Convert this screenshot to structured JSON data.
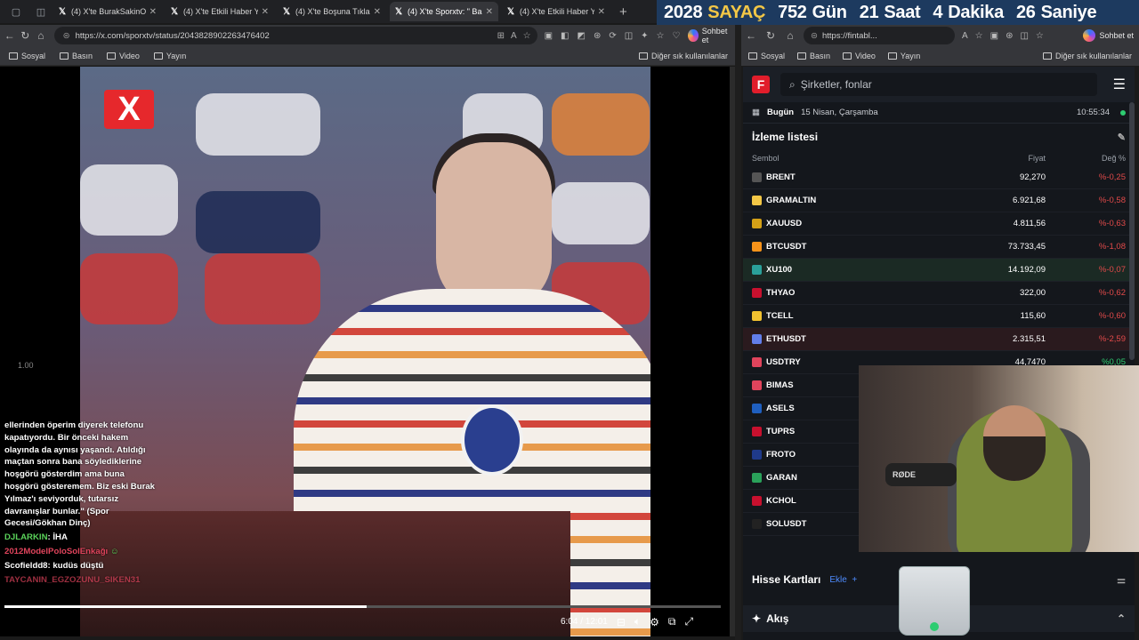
{
  "left_browser": {
    "tabs": [
      {
        "title": "(4) X'te BurakSakinOl: \"G",
        "active": false
      },
      {
        "title": "(4) X'te Etkili Haber Yeni",
        "active": false
      },
      {
        "title": "(4) X'te Boşuna Tıklama:",
        "active": false
      },
      {
        "title": "(4) X'te Sporxtv: \" Bah",
        "active": true
      },
      {
        "title": "(4) X'te Etkili Haber Yeni",
        "active": false
      }
    ],
    "url": "https://x.com/sporxtv/status/2043828902263476402",
    "sohbet": "Sohbet et",
    "bookmarks": [
      "Sosyal",
      "Basın",
      "Video",
      "Yayın"
    ],
    "other_bookmarks": "Diğer sık kullanılanlar"
  },
  "countdown": {
    "year": "2028",
    "label": "SAYAÇ",
    "days": "752",
    "days_label": "Gün",
    "hours": "21",
    "hours_label": "Saat",
    "minutes": "4",
    "minutes_label": "Dakika",
    "seconds": "26",
    "seconds_label": "Saniye"
  },
  "video": {
    "ratio_label": "1.00",
    "time": "6:04 / 12:01",
    "progress": 0.505,
    "badge": "X"
  },
  "chat": {
    "quote": "ellerinden öperim diyerek telefonu kapatıyordu. Bir önceki hakem olayında da aynısı yaşandı. Atıldığı maçtan sonra bana söylediklerine hoşgörü gösterdim ama buna hoşgörü gösteremem. Biz eski Burak Yılmaz'ı seviyorduk, tutarsız davranışlar bunlar.\" (Spor Gecesi/Gökhan Dinç)",
    "lines": [
      {
        "user": "DJLARKIN",
        "text": "İHA"
      },
      {
        "user": "2012ModelPoloSolEnkağı",
        "text": ""
      },
      {
        "user": "Scofieldd8",
        "text": "kudüs düştü"
      },
      {
        "user": "TAYCANIN_EGZOZUNU_SIKEN31",
        "text": ""
      }
    ]
  },
  "right_browser": {
    "url": "https://fintabl...",
    "sohbet": "Sohbet et",
    "bookmarks": [
      "Sosyal",
      "Basın",
      "Video",
      "Yayın"
    ],
    "other_bookmarks": "Diğer sık kullanılanlar"
  },
  "fintables": {
    "logo": "F",
    "search_placeholder": "Şirketler, fonlar",
    "today_label": "Bugün",
    "date": "15 Nisan, Çarşamba",
    "time": "10:55:34",
    "watchlist_title": "İzleme listesi",
    "col_symbol": "Sembol",
    "col_price": "Fiyat",
    "col_change": "Değ %",
    "rows": [
      {
        "symbol": "BRENT",
        "price": "92,270",
        "change": "%-0,25",
        "icon_color": "#555555",
        "pos": false
      },
      {
        "symbol": "GRAMALTIN",
        "price": "6.921,68",
        "change": "%-0,58",
        "icon_color": "#f3c746",
        "pos": false
      },
      {
        "symbol": "XAUUSD",
        "price": "4.811,56",
        "change": "%-0,63",
        "icon_color": "#d4a017",
        "pos": false
      },
      {
        "symbol": "BTCUSDT",
        "price": "73.733,45",
        "change": "%-1,08",
        "icon_color": "#f7931a",
        "pos": false
      },
      {
        "symbol": "XU100",
        "price": "14.192,09",
        "change": "%-0,07",
        "icon_color": "#2aa19a",
        "pos": false
      },
      {
        "symbol": "THYAO",
        "price": "322,00",
        "change": "%-0,62",
        "icon_color": "#c8102e",
        "pos": false
      },
      {
        "symbol": "TCELL",
        "price": "115,60",
        "change": "%-0,60",
        "icon_color": "#f2c230",
        "pos": false
      },
      {
        "symbol": "ETHUSDT",
        "price": "2.315,51",
        "change": "%-2,59",
        "icon_color": "#627eea",
        "pos": false
      },
      {
        "symbol": "USDTRY",
        "price": "44,7470",
        "change": "%0,05",
        "icon_color": "#e0445c",
        "pos": true
      },
      {
        "symbol": "BIMAS",
        "price": "",
        "change": "",
        "icon_color": "#e0445c",
        "pos": false
      },
      {
        "symbol": "ASELS",
        "price": "",
        "change": "",
        "icon_color": "#1f5fbf",
        "pos": false
      },
      {
        "symbol": "TUPRS",
        "price": "",
        "change": "",
        "icon_color": "#c8102e",
        "pos": false
      },
      {
        "symbol": "FROTO",
        "price": "",
        "change": "",
        "icon_color": "#1f3a8a",
        "pos": false
      },
      {
        "symbol": "GARAN",
        "price": "",
        "change": "",
        "icon_color": "#2aa15a",
        "pos": false
      },
      {
        "symbol": "KCHOL",
        "price": "",
        "change": "",
        "icon_color": "#c8102e",
        "pos": false
      },
      {
        "symbol": "SOLUSDT",
        "price": "",
        "change": "",
        "icon_color": "#222222",
        "pos": false
      }
    ],
    "cards_title": "Hisse Kartları",
    "cards_add": "Ekle",
    "flow_title": "Akış"
  },
  "webcam": {
    "mic_brand": "RØDE"
  }
}
